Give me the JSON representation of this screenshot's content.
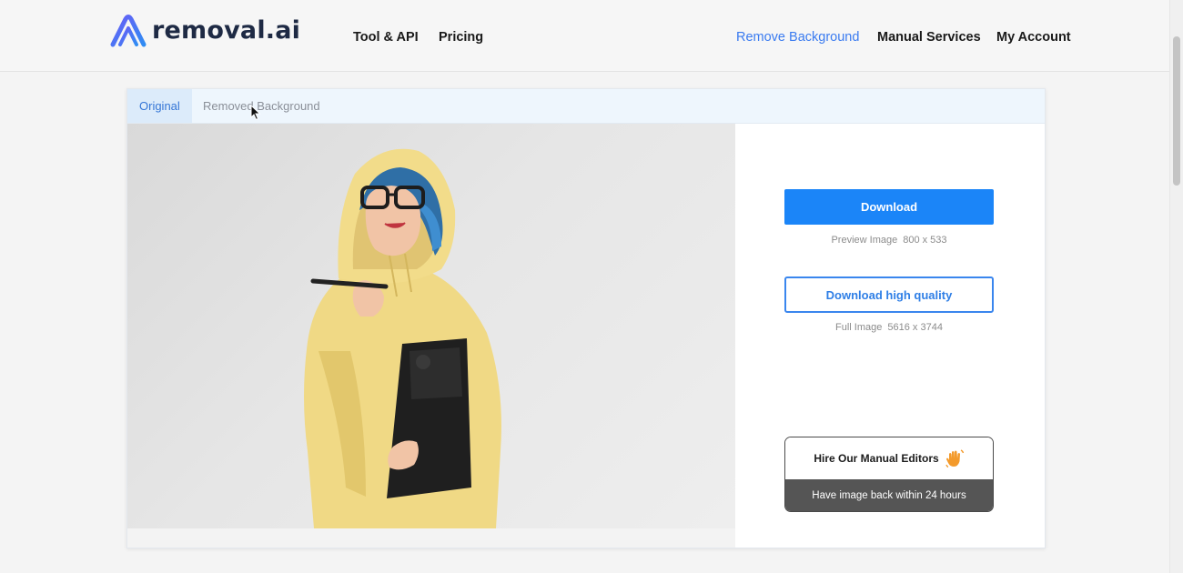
{
  "brand": {
    "name": "removal.ai",
    "accent": "#3a7bf0"
  },
  "nav": {
    "left": [
      {
        "label": "Tool & API"
      },
      {
        "label": "Pricing"
      }
    ],
    "right": [
      {
        "label": "Remove Background",
        "active": true
      },
      {
        "label": "Manual Services"
      },
      {
        "label": "My Account"
      }
    ]
  },
  "tabs": [
    {
      "label": "Original",
      "active": true
    },
    {
      "label": "Removed Background",
      "active": false
    }
  ],
  "panel": {
    "download_label": "Download",
    "preview_label": "Preview Image",
    "preview_size": "800 x 533",
    "download_hq_label": "Download high quality",
    "full_label": "Full Image",
    "full_size": "5616 x 3744",
    "hire_label": "Hire Our Manual Editors",
    "hire_sub": "Have image back within 24 hours"
  },
  "icons": {
    "logo": "removal-ai-logo-icon",
    "hire": "waving-hand-icon",
    "cursor": "mouse-pointer-icon"
  },
  "colors": {
    "primary_button": "#1b85f8",
    "outline_button": "#3a86ee",
    "hoodie": "#f2dd8a"
  }
}
